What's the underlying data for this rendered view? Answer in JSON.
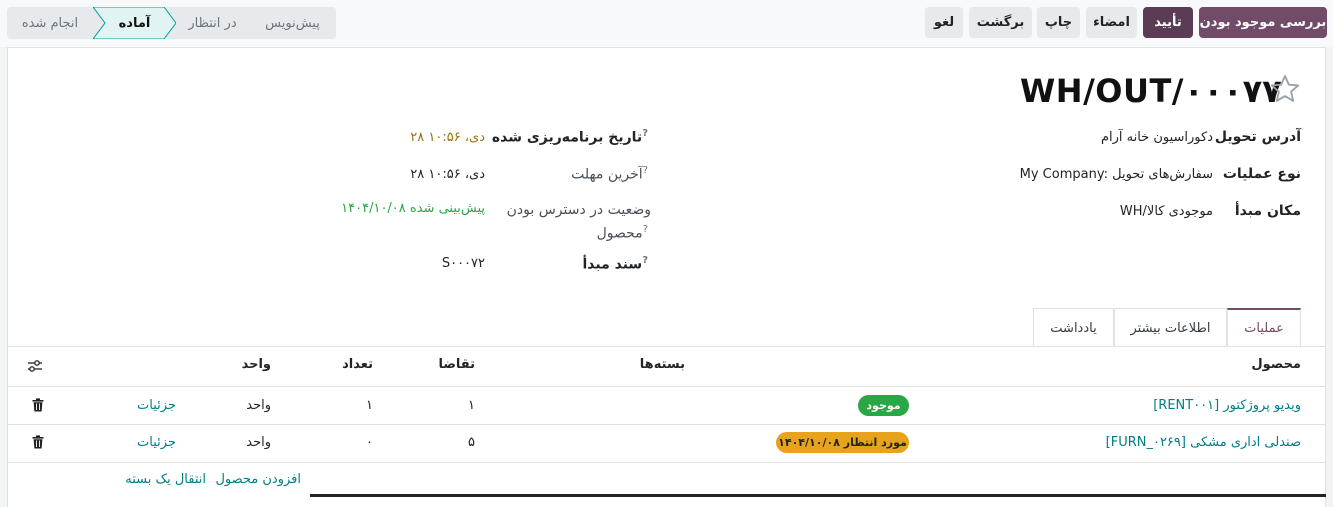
{
  "toolbar": {
    "check_availability": "بررسی موجود بودن",
    "validate": "تأیید",
    "sign": "امضاء",
    "print": "چاپ",
    "return": "برگشت",
    "cancel": "لغو"
  },
  "statusbar": {
    "stages": [
      "پیش‌نویس",
      "در انتظار",
      "آماده",
      "انجام شده"
    ],
    "active": "آماده"
  },
  "record": {
    "title": "WH/OUT/۰۰۰۷۷",
    "favorite": false
  },
  "fields_right": [
    {
      "label": "آدرس تحویل",
      "value": "دکوراسیون خانه آرام"
    },
    {
      "label": "نوع عملیات",
      "value": "My Company: سفارش‌های تحویل"
    },
    {
      "label": "مکان مبدأ",
      "value": "WH/موجودی کالا"
    }
  ],
  "fields_left": [
    {
      "label": "تاریخ برنامه‌ریزی شده",
      "value": "۲۸ دی، ۱۰:۵۶",
      "help": "?"
    },
    {
      "label": "آخرین مهلت",
      "value": "۲۸ دی، ۱۰:۵۶",
      "help": "?"
    },
    {
      "label_line1": "وضعیت در دسترس بودن",
      "label_line2": "محصول",
      "value": "۱۴۰۴/۱۰/۰۸ پیش‌بینی شده",
      "help": "?"
    },
    {
      "label": "سند مبدأ",
      "value": "S۰۰۰۷۲",
      "help": "?"
    }
  ],
  "tabs": [
    "عملیات",
    "اطلاعات بیشتر",
    "یادداشت"
  ],
  "table": {
    "headers": {
      "product": "محصول",
      "packages": "بسته‌ها",
      "demand": "تقاضا",
      "quantity": "تعداد",
      "unit": "واحد"
    },
    "rows": [
      {
        "product": "[RENT۰۰۱] ویدیو پروژکتور",
        "badge": "موجود",
        "badge_color": "#28a745",
        "demand": "۱",
        "quantity": "۱",
        "unit": "واحد",
        "details": "جزئیات"
      },
      {
        "product": "[FURN_۰۲۶۹] صندلی اداری مشکی",
        "badge": "مورد انتظار ۱۴۰۴/۱۰/۰۸",
        "badge_color": "#e8a31c",
        "demand": "۵",
        "quantity": "۰",
        "unit": "واحد",
        "details": "جزئیات"
      }
    ],
    "add_product": "افزودن محصول",
    "add_package": "انتقال یک بسته"
  },
  "colors": {
    "brand": "#714b67",
    "link": "#017e84",
    "warning_date": "#9a7213",
    "success": "#28a745"
  }
}
